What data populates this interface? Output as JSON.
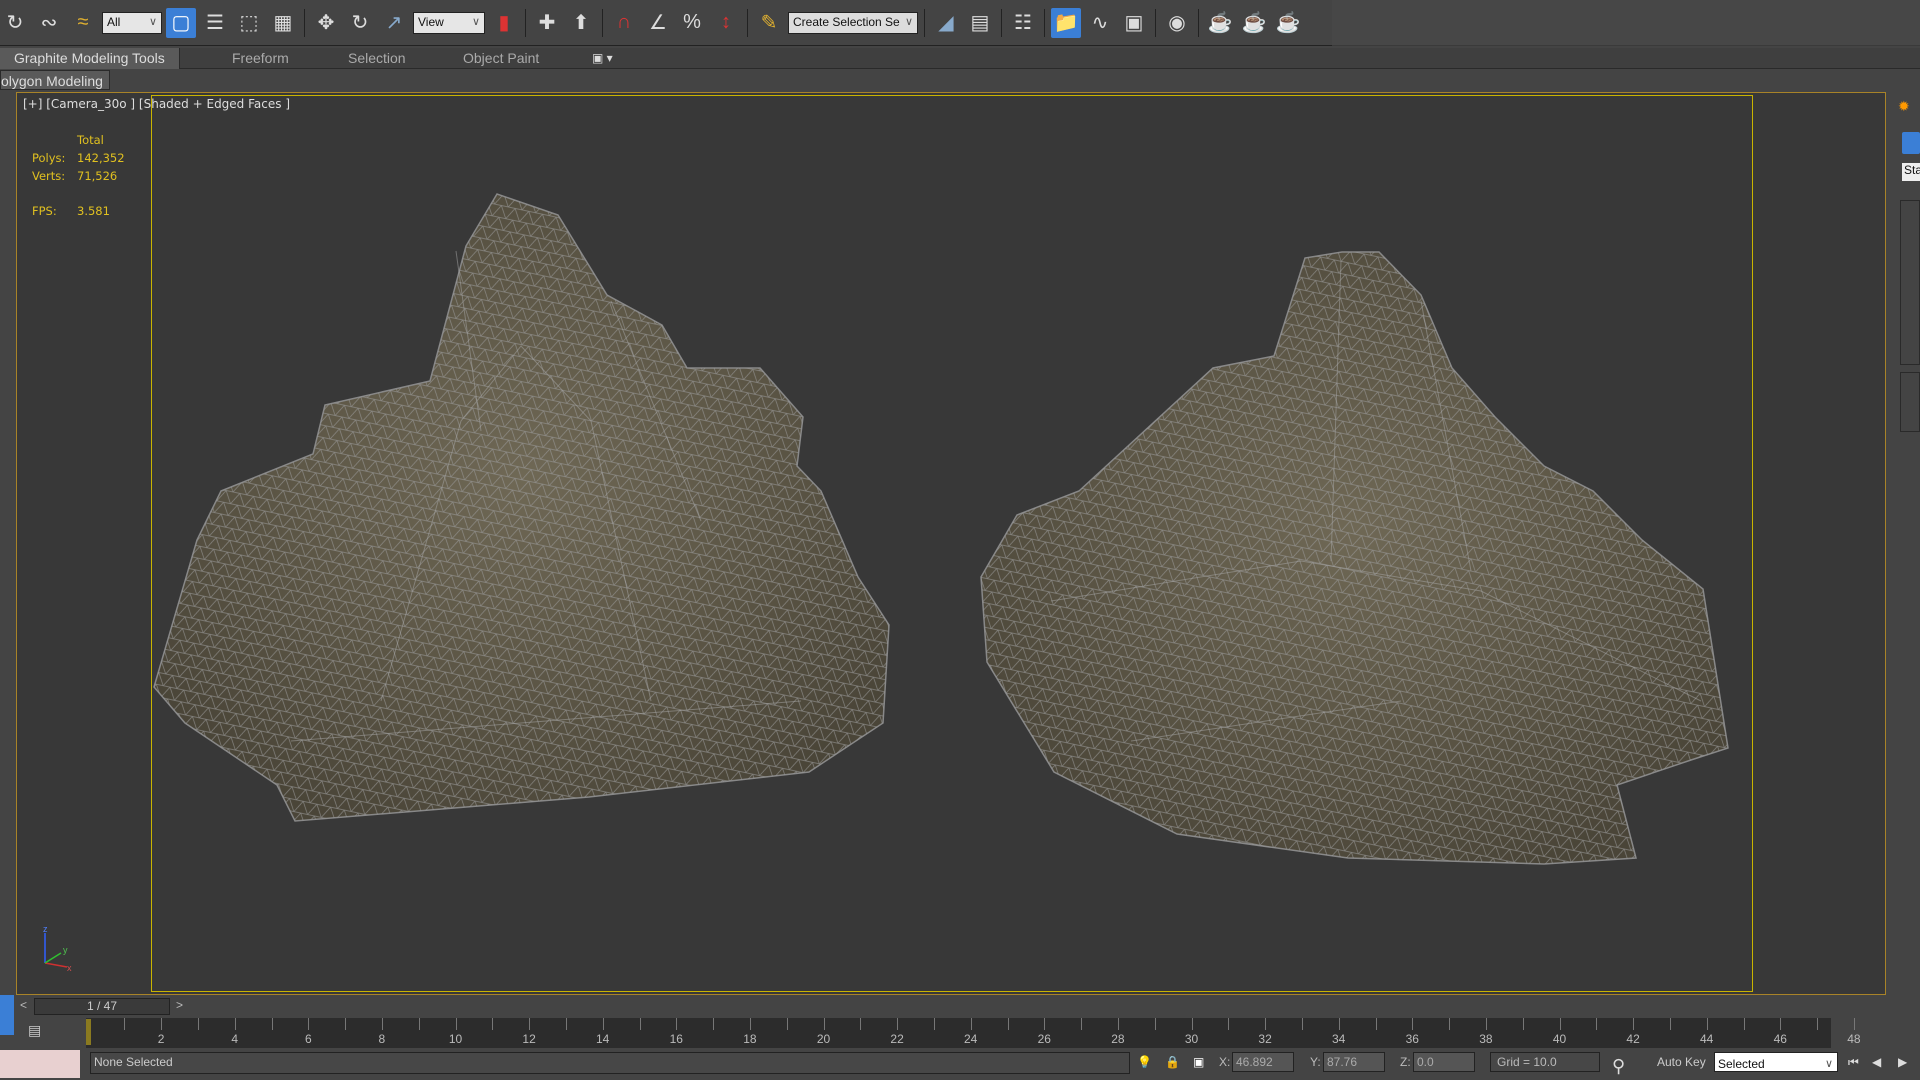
{
  "toolbar": {
    "selection_filter": "All",
    "reference_coord": "View",
    "named_selection_placeholder": "Create Selection Se"
  },
  "ribbon": {
    "tabs": [
      "Graphite Modeling Tools",
      "Freeform",
      "Selection",
      "Object Paint"
    ],
    "active_panel": "olygon Modeling"
  },
  "viewport": {
    "label": "[+] [Camera_30o ] [Shaded + Edged Faces ]",
    "stats": {
      "total_label": "Total",
      "polys_label": "Polys:",
      "polys": "142,352",
      "verts_label": "Verts:",
      "verts": "71,526",
      "fps_label": "FPS:",
      "fps": "3.581"
    },
    "axis": {
      "z": "z",
      "x": "x",
      "y": "y"
    }
  },
  "command_panel": {
    "type_field": "Sta"
  },
  "timeslider": {
    "prev": "<",
    "frame": "1 / 47",
    "next": ">"
  },
  "timeline": {
    "labels": [
      2,
      4,
      6,
      8,
      10,
      12,
      14,
      16,
      18,
      20,
      22,
      24,
      26,
      28,
      30,
      32,
      34,
      36,
      38,
      40,
      42,
      44,
      46,
      48
    ]
  },
  "status": {
    "selection": "None Selected",
    "x_label": "X:",
    "x": "46.892",
    "y_label": "Y:",
    "y": "87.76",
    "z_label": "Z:",
    "z": "0.0",
    "grid": "Grid = 10.0",
    "auto_key": "Auto Key",
    "key_filter": "Selected"
  },
  "colors": {
    "accent": "#3b7fd6",
    "safe_frame": "#c8b400",
    "stats": "#e0c020",
    "viewport_bg": "#383838"
  }
}
